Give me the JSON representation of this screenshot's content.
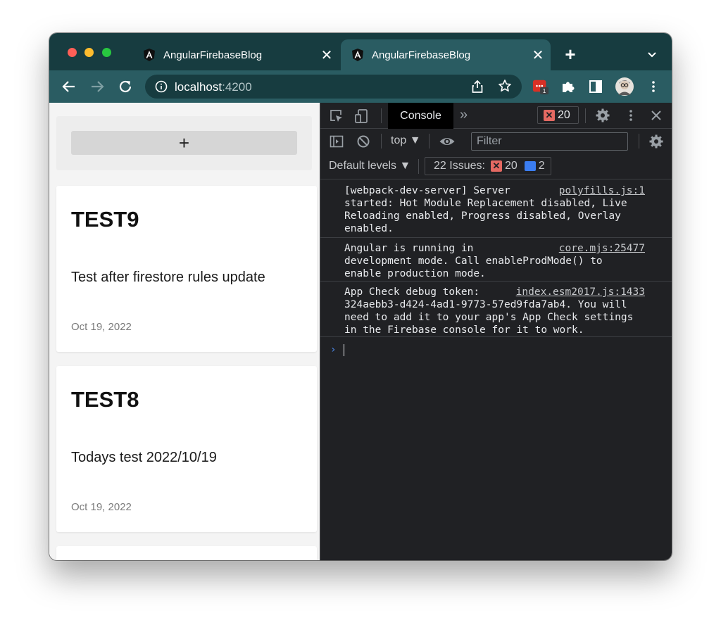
{
  "tabs": [
    {
      "title": "AngularFirebaseBlog",
      "close": "✕"
    },
    {
      "title": "AngularFirebaseBlog",
      "close": "✕"
    }
  ],
  "new_tab": "+",
  "toolbar": {
    "url_host": "localhost",
    "url_port": ":4200",
    "extension_badge": "1"
  },
  "page": {
    "add_button": "+",
    "posts": [
      {
        "title": "TEST9",
        "body": "Test after firestore rules update",
        "date": "Oct 19, 2022"
      },
      {
        "title": "TEST8",
        "body": "Todays test 2022/10/19",
        "date": "Oct 19, 2022"
      }
    ]
  },
  "devtools": {
    "active_tab": "Console",
    "more_tabs": "»",
    "error_count": "20",
    "context": "top ▼",
    "filter_placeholder": "Filter",
    "levels": "Default levels ▼",
    "issues_label": "22 Issues:",
    "issues_errors": "20",
    "issues_messages": "2",
    "logs": [
      {
        "text": "[webpack-dev-server] Server\nstarted: Hot Module Replacement disabled, Live\nReloading enabled, Progress disabled, Overlay\nenabled.",
        "source": "polyfills.js:1"
      },
      {
        "text": "Angular is running in\ndevelopment mode. Call enableProdMode() to\nenable production mode.",
        "source": "core.mjs:25477"
      },
      {
        "text": "App Check debug token:\n324aebb3-d424-4ad1-9773-57ed9fda7ab4. You will\nneed to add it to your app's App Check settings\nin the Firebase console for it to work.",
        "source": "index.esm2017.js:1433"
      }
    ],
    "prompt": "›"
  },
  "colors": {
    "tabstrip": "#173c40",
    "toolbar": "#2a5c62",
    "devtools_bg": "#202124",
    "error_red": "#e46962",
    "message_blue": "#3b7df0"
  }
}
